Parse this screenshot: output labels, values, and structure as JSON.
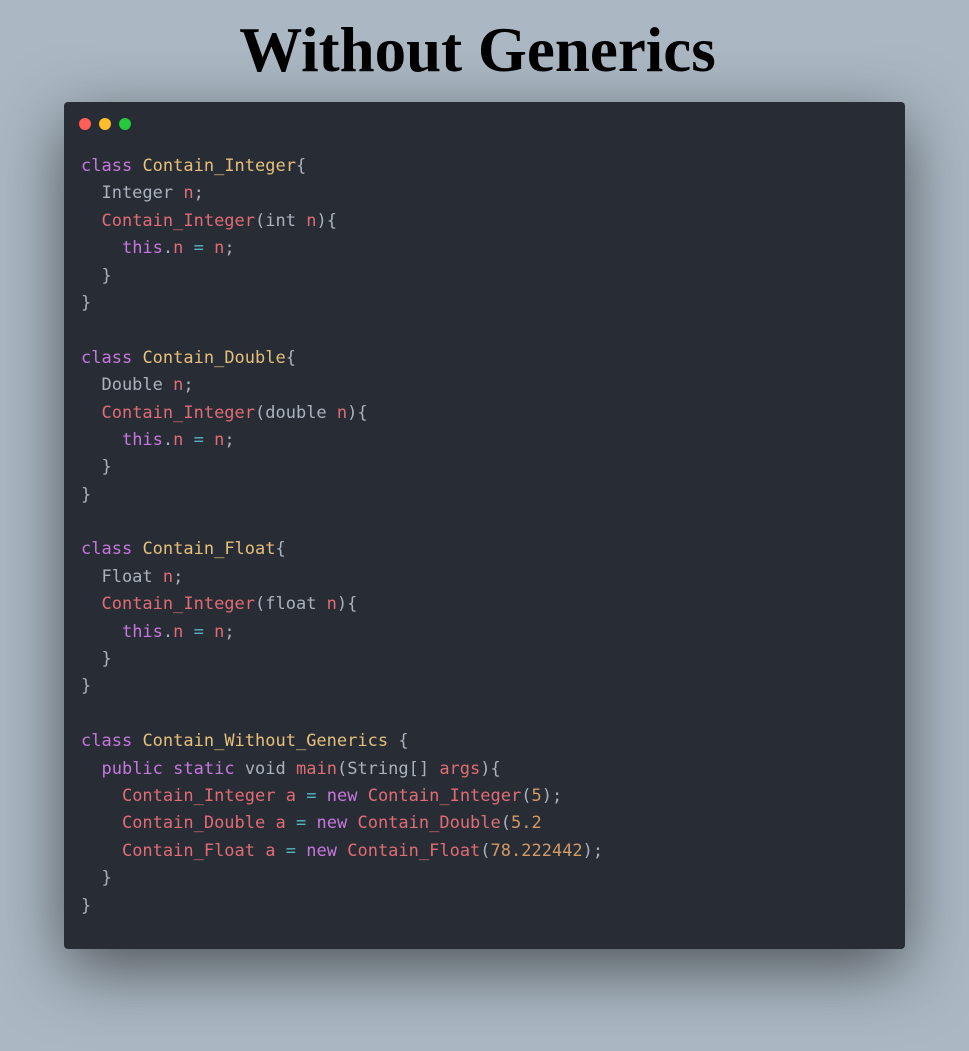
{
  "page": {
    "title": "Without Generics"
  },
  "window": {
    "controls": [
      {
        "name": "close-dot",
        "color": "#ff5f56"
      },
      {
        "name": "minimize-dot",
        "color": "#ffbd2e"
      },
      {
        "name": "maximize-dot",
        "color": "#27c93f"
      }
    ]
  },
  "colors": {
    "keyword": "#c678dd",
    "class": "#e5c07b",
    "variable": "#e06c75",
    "operator": "#56b6c2",
    "number": "#d19a66",
    "plain": "#abb2bf"
  },
  "code": {
    "language": "java",
    "lines": [
      [
        {
          "t": "class",
          "c": "keyword"
        },
        {
          "t": " ",
          "c": "plain"
        },
        {
          "t": "Contain_Integer",
          "c": "class"
        },
        {
          "t": "{",
          "c": "plain"
        }
      ],
      [
        {
          "t": "  Integer ",
          "c": "plain"
        },
        {
          "t": "n",
          "c": "variable"
        },
        {
          "t": ";",
          "c": "plain"
        }
      ],
      [
        {
          "t": "  ",
          "c": "plain"
        },
        {
          "t": "Contain_Integer",
          "c": "variable"
        },
        {
          "t": "(int ",
          "c": "plain"
        },
        {
          "t": "n",
          "c": "variable"
        },
        {
          "t": "){",
          "c": "plain"
        }
      ],
      [
        {
          "t": "    ",
          "c": "plain"
        },
        {
          "t": "this",
          "c": "keyword"
        },
        {
          "t": ".",
          "c": "plain"
        },
        {
          "t": "n",
          "c": "variable"
        },
        {
          "t": " ",
          "c": "plain"
        },
        {
          "t": "=",
          "c": "operator"
        },
        {
          "t": " ",
          "c": "plain"
        },
        {
          "t": "n",
          "c": "variable"
        },
        {
          "t": ";",
          "c": "plain"
        }
      ],
      [
        {
          "t": "  }",
          "c": "plain"
        }
      ],
      [
        {
          "t": "}",
          "c": "plain"
        }
      ],
      [],
      [
        {
          "t": "class",
          "c": "keyword"
        },
        {
          "t": " ",
          "c": "plain"
        },
        {
          "t": "Contain_Double",
          "c": "class"
        },
        {
          "t": "{",
          "c": "plain"
        }
      ],
      [
        {
          "t": "  Double ",
          "c": "plain"
        },
        {
          "t": "n",
          "c": "variable"
        },
        {
          "t": ";",
          "c": "plain"
        }
      ],
      [
        {
          "t": "  ",
          "c": "plain"
        },
        {
          "t": "Contain_Integer",
          "c": "variable"
        },
        {
          "t": "(double ",
          "c": "plain"
        },
        {
          "t": "n",
          "c": "variable"
        },
        {
          "t": "){",
          "c": "plain"
        }
      ],
      [
        {
          "t": "    ",
          "c": "plain"
        },
        {
          "t": "this",
          "c": "keyword"
        },
        {
          "t": ".",
          "c": "plain"
        },
        {
          "t": "n",
          "c": "variable"
        },
        {
          "t": " ",
          "c": "plain"
        },
        {
          "t": "=",
          "c": "operator"
        },
        {
          "t": " ",
          "c": "plain"
        },
        {
          "t": "n",
          "c": "variable"
        },
        {
          "t": ";",
          "c": "plain"
        }
      ],
      [
        {
          "t": "  }",
          "c": "plain"
        }
      ],
      [
        {
          "t": "}",
          "c": "plain"
        }
      ],
      [],
      [
        {
          "t": "class",
          "c": "keyword"
        },
        {
          "t": " ",
          "c": "plain"
        },
        {
          "t": "Contain_Float",
          "c": "class"
        },
        {
          "t": "{",
          "c": "plain"
        }
      ],
      [
        {
          "t": "  Float ",
          "c": "plain"
        },
        {
          "t": "n",
          "c": "variable"
        },
        {
          "t": ";",
          "c": "plain"
        }
      ],
      [
        {
          "t": "  ",
          "c": "plain"
        },
        {
          "t": "Contain_Integer",
          "c": "variable"
        },
        {
          "t": "(float ",
          "c": "plain"
        },
        {
          "t": "n",
          "c": "variable"
        },
        {
          "t": "){",
          "c": "plain"
        }
      ],
      [
        {
          "t": "    ",
          "c": "plain"
        },
        {
          "t": "this",
          "c": "keyword"
        },
        {
          "t": ".",
          "c": "plain"
        },
        {
          "t": "n",
          "c": "variable"
        },
        {
          "t": " ",
          "c": "plain"
        },
        {
          "t": "=",
          "c": "operator"
        },
        {
          "t": " ",
          "c": "plain"
        },
        {
          "t": "n",
          "c": "variable"
        },
        {
          "t": ";",
          "c": "plain"
        }
      ],
      [
        {
          "t": "  }",
          "c": "plain"
        }
      ],
      [
        {
          "t": "}",
          "c": "plain"
        }
      ],
      [],
      [
        {
          "t": "class",
          "c": "keyword"
        },
        {
          "t": " ",
          "c": "plain"
        },
        {
          "t": "Contain_Without_Generics",
          "c": "class"
        },
        {
          "t": " {",
          "c": "plain"
        }
      ],
      [
        {
          "t": "  ",
          "c": "plain"
        },
        {
          "t": "public",
          "c": "keyword"
        },
        {
          "t": " ",
          "c": "plain"
        },
        {
          "t": "static",
          "c": "keyword"
        },
        {
          "t": " void ",
          "c": "plain"
        },
        {
          "t": "main",
          "c": "variable"
        },
        {
          "t": "(String[] ",
          "c": "plain"
        },
        {
          "t": "args",
          "c": "variable"
        },
        {
          "t": "){",
          "c": "plain"
        }
      ],
      [
        {
          "t": "    ",
          "c": "plain"
        },
        {
          "t": "Contain_Integer",
          "c": "variable"
        },
        {
          "t": " ",
          "c": "plain"
        },
        {
          "t": "a",
          "c": "variable"
        },
        {
          "t": " ",
          "c": "plain"
        },
        {
          "t": "=",
          "c": "operator"
        },
        {
          "t": " ",
          "c": "plain"
        },
        {
          "t": "new",
          "c": "keyword"
        },
        {
          "t": " ",
          "c": "plain"
        },
        {
          "t": "Contain_Integer",
          "c": "variable"
        },
        {
          "t": "(",
          "c": "plain"
        },
        {
          "t": "5",
          "c": "number"
        },
        {
          "t": ");",
          "c": "plain"
        }
      ],
      [
        {
          "t": "    ",
          "c": "plain"
        },
        {
          "t": "Contain_Double",
          "c": "variable"
        },
        {
          "t": " ",
          "c": "plain"
        },
        {
          "t": "a",
          "c": "variable"
        },
        {
          "t": " ",
          "c": "plain"
        },
        {
          "t": "=",
          "c": "operator"
        },
        {
          "t": " ",
          "c": "plain"
        },
        {
          "t": "new",
          "c": "keyword"
        },
        {
          "t": " ",
          "c": "plain"
        },
        {
          "t": "Contain_Double",
          "c": "variable"
        },
        {
          "t": "(",
          "c": "plain"
        },
        {
          "t": "5.2",
          "c": "number"
        }
      ],
      [
        {
          "t": "    ",
          "c": "plain"
        },
        {
          "t": "Contain_Float",
          "c": "variable"
        },
        {
          "t": " ",
          "c": "plain"
        },
        {
          "t": "a",
          "c": "variable"
        },
        {
          "t": " ",
          "c": "plain"
        },
        {
          "t": "=",
          "c": "operator"
        },
        {
          "t": " ",
          "c": "plain"
        },
        {
          "t": "new",
          "c": "keyword"
        },
        {
          "t": " ",
          "c": "plain"
        },
        {
          "t": "Contain_Float",
          "c": "variable"
        },
        {
          "t": "(",
          "c": "plain"
        },
        {
          "t": "78.222442",
          "c": "number"
        },
        {
          "t": ");",
          "c": "plain"
        }
      ],
      [
        {
          "t": "  }",
          "c": "plain"
        }
      ],
      [
        {
          "t": "}",
          "c": "plain"
        }
      ]
    ]
  }
}
